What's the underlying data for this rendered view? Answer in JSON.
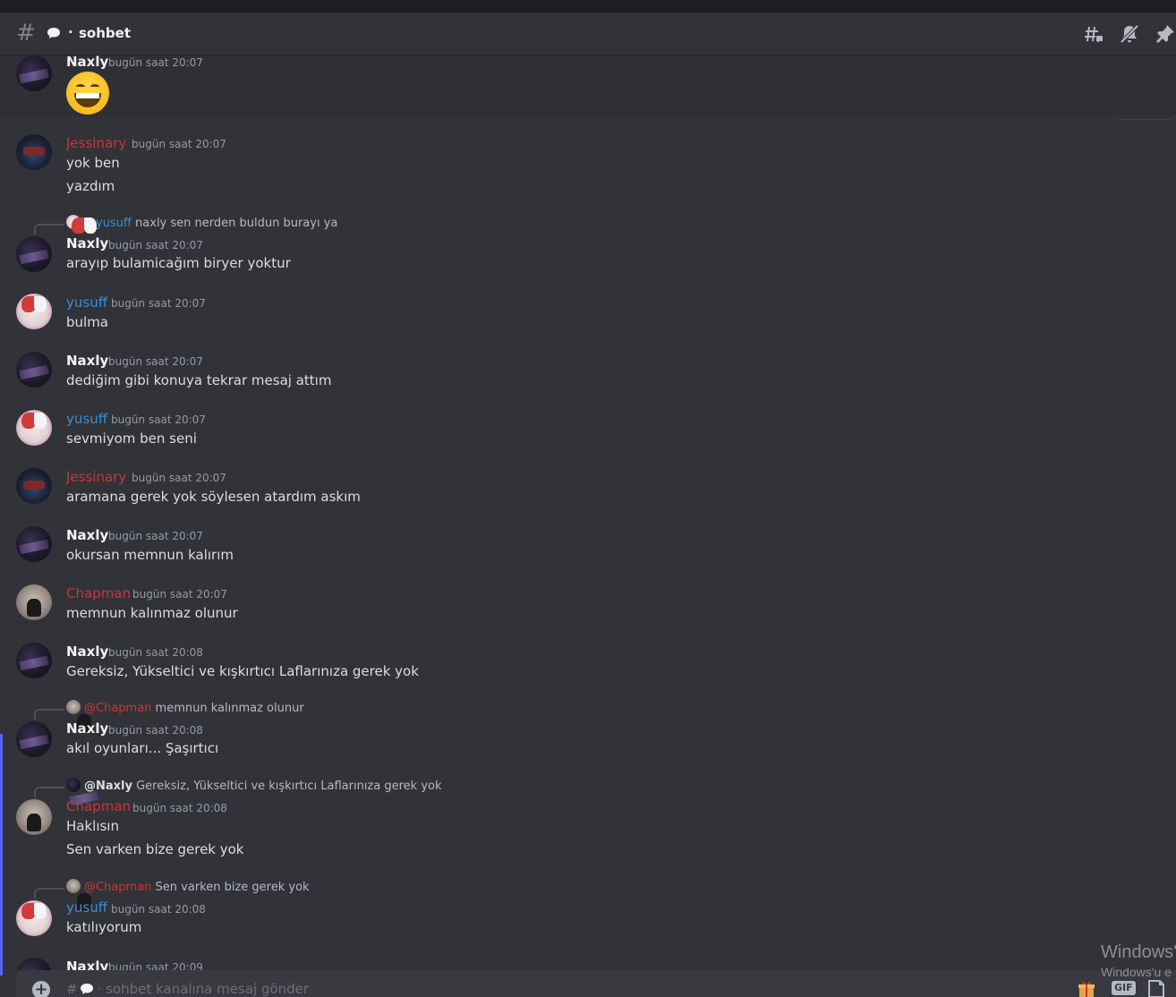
{
  "header": {
    "channel_prefix": "·",
    "channel_name": "sohbet"
  },
  "messages": [
    {
      "author": "Naxly",
      "time": "bugün saat 20:07",
      "lines": [],
      "emoji": "grinning-face"
    },
    {
      "author": "Jessinary",
      "time": "bugün saat 20:07",
      "lines": [
        "yok ben",
        "yazdım"
      ]
    },
    {
      "reply": {
        "mention": "@yusuff",
        "text": "naxly sen nerden buldun burayı ya"
      },
      "author": "Naxly",
      "time": "bugün saat 20:07",
      "lines": [
        "arayıp bulamicağım biryer yoktur"
      ]
    },
    {
      "author": "yusuff",
      "time": "bugün saat 20:07",
      "lines": [
        "bulma"
      ]
    },
    {
      "author": "Naxly",
      "time": "bugün saat 20:07",
      "lines": [
        "dediğim gibi konuya tekrar mesaj attım"
      ]
    },
    {
      "author": "yusuff",
      "time": "bugün saat 20:07",
      "lines": [
        "sevmiyom ben seni"
      ]
    },
    {
      "author": "Jessinary",
      "time": "bugün saat 20:07",
      "lines": [
        "aramana gerek yok söylesen atardım askım"
      ]
    },
    {
      "author": "Naxly",
      "time": "bugün saat 20:07",
      "lines": [
        "okursan memnun kalırım"
      ]
    },
    {
      "author": "Chapman",
      "time": "bugün saat 20:07",
      "lines": [
        "memnun kalınmaz olunur"
      ]
    },
    {
      "author": "Naxly",
      "time": "bugün saat 20:08",
      "lines": [
        "Gereksiz, Yükseltici ve kışkırtıcı Laflarınıza gerek yok"
      ]
    },
    {
      "reply": {
        "mention": "@Chapman",
        "text": "memnun kalınmaz olunur"
      },
      "author": "Naxly",
      "time": "bugün saat 20:08",
      "lines": [
        "akıl oyunları... Şaşırtıcı"
      ]
    },
    {
      "reply": {
        "mention": "@Naxly",
        "text": "Gereksiz, Yükseltici ve kışkırtıcı Laflarınıza gerek yok"
      },
      "author": "Chapman",
      "time": "bugün saat 20:08",
      "lines": [
        "Haklısın",
        "Sen varken bize gerek yok"
      ]
    },
    {
      "reply": {
        "mention": "@Chapman",
        "text": "Sen varken bize gerek yok"
      },
      "author": "yusuff",
      "time": "bugün saat 20:08",
      "lines": [
        "katılıyorum"
      ]
    },
    {
      "author": "Naxly",
      "time": "bugün saat 20:09",
      "lines": []
    }
  ],
  "composer": {
    "placeholder": "· sohbet kanalına mesaj gönder",
    "gif_label": "GIF"
  },
  "watermark": {
    "line1": "Windows'",
    "line2": "Windows'u e"
  },
  "colors": {
    "background": "#313338",
    "accent": "#5865f2",
    "role_red": "#c8363b",
    "role_blue": "#3a8fd8"
  }
}
